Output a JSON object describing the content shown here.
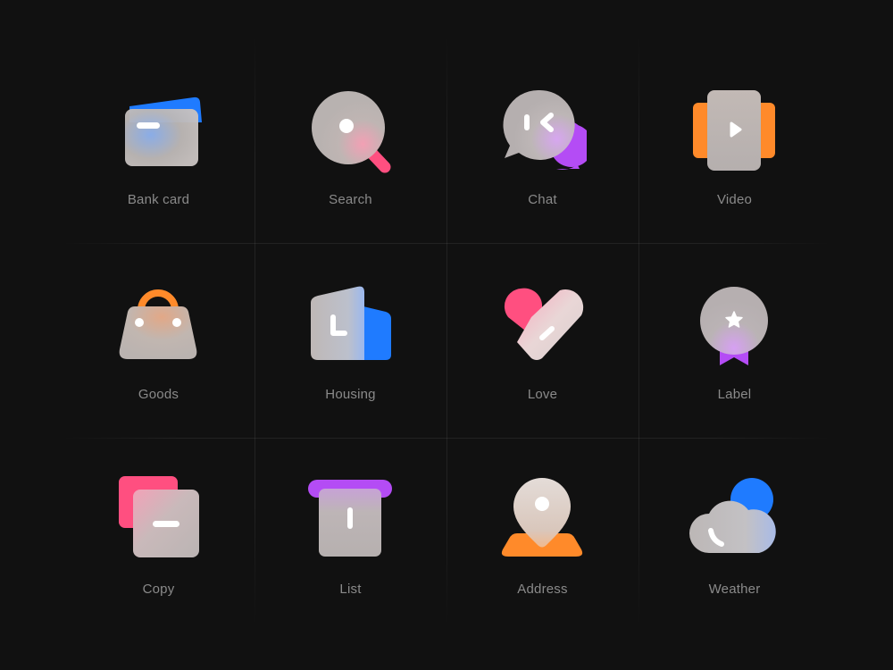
{
  "colors": {
    "background": "#111111",
    "blue": "#1F7BFF",
    "pink": "#FF4F80",
    "purple": "#B44CF5",
    "orange": "#FF8A2A",
    "glass": "#B9B4B2",
    "label": "#8A8A8A"
  },
  "icons": [
    {
      "label": "Bank card",
      "icon": "bank-card-icon"
    },
    {
      "label": "Search",
      "icon": "search-icon"
    },
    {
      "label": "Chat",
      "icon": "chat-icon"
    },
    {
      "label": "Video",
      "icon": "video-icon"
    },
    {
      "label": "Goods",
      "icon": "goods-bag-icon"
    },
    {
      "label": "Housing",
      "icon": "housing-icon"
    },
    {
      "label": "Love",
      "icon": "heart-icon"
    },
    {
      "label": "Label",
      "icon": "badge-label-icon"
    },
    {
      "label": "Copy",
      "icon": "copy-icon"
    },
    {
      "label": "List",
      "icon": "list-icon"
    },
    {
      "label": "Address",
      "icon": "map-pin-icon"
    },
    {
      "label": "Weather",
      "icon": "weather-cloud-icon"
    }
  ]
}
